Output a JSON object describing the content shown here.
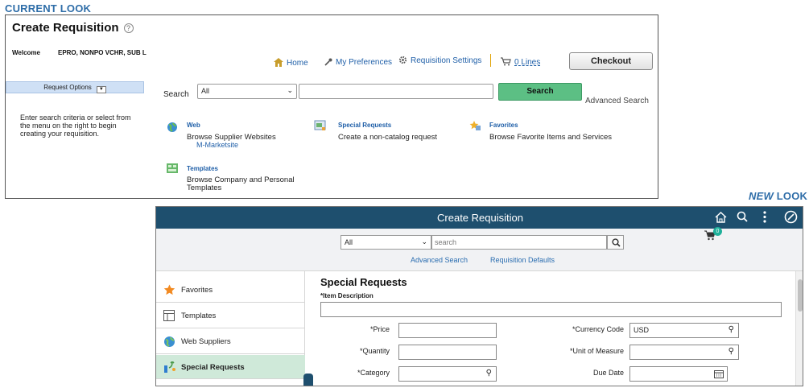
{
  "captions": {
    "current": "CURRENT LOOK",
    "new_prefix": "NEW",
    "new_suffix": " LOOK"
  },
  "old": {
    "title": "Create Requisition",
    "welcome_label": "Welcome",
    "welcome_name": "EPRO, NONPO VCHR, SUB L",
    "nav": {
      "home": "Home",
      "preferences": "My Preferences",
      "settings": "Requisition Settings",
      "cart": "0 Lines"
    },
    "checkout": "Checkout",
    "request_options": "Request Options",
    "help_text": "Enter search criteria or select from the menu on the right to begin creating your requisition.",
    "search_label": "Search",
    "search_select": "All",
    "search_button": "Search",
    "advanced_search": "Advanced Search",
    "items": {
      "web": {
        "title": "Web",
        "desc": "Browse Supplier Websites",
        "link": "M-Marketsite"
      },
      "special": {
        "title": "Special Requests",
        "desc": "Create a non-catalog request"
      },
      "favorites": {
        "title": "Favorites",
        "desc": "Browse Favorite Items and Services"
      },
      "templates": {
        "title": "Templates",
        "desc": "Browse Company and Personal Templates"
      }
    }
  },
  "new": {
    "title": "Create Requisition",
    "search_select": "All",
    "search_placeholder": "search",
    "advanced_search": "Advanced Search",
    "requisition_defaults": "Requisition Defaults",
    "cart_count": "0",
    "sidebar": [
      {
        "label": "Favorites",
        "selected": false
      },
      {
        "label": "Templates",
        "selected": false
      },
      {
        "label": "Web Suppliers",
        "selected": false
      },
      {
        "label": "Special Requests",
        "selected": true
      }
    ],
    "form": {
      "heading": "Special Requests",
      "item_description": "*Item Description",
      "price": "*Price",
      "quantity": "*Quantity",
      "category": "*Category",
      "currency_code": "*Currency Code",
      "currency_value": "USD",
      "unit_of_measure": "*Unit of Measure",
      "due_date": "Due Date"
    }
  },
  "colors": {
    "header": "#1e4f6e",
    "caption": "#2e6da8",
    "link": "#1f5fa8",
    "search_btn": "#5cbf84",
    "selected": "#cfe9d9"
  }
}
